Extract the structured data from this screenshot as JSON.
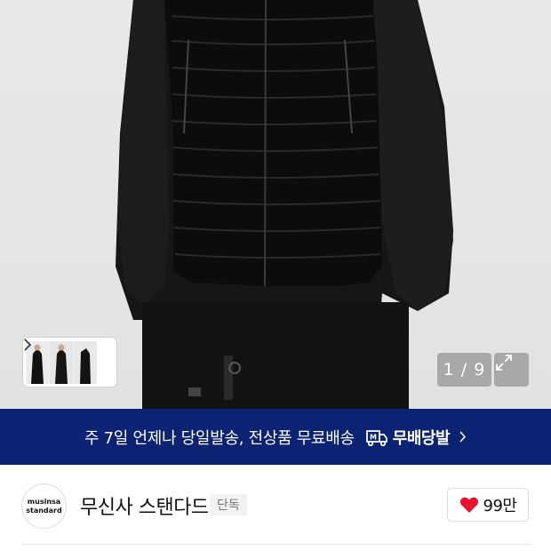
{
  "product": {
    "image_alt": "black padded vest worn over black shirt",
    "thumbnail_alt": "product thumbnails",
    "counter": "1 / 9"
  },
  "banner": {
    "text": "주 7일 언제나 당일발송, 전상품 무료배송",
    "logo_text": "무배당발"
  },
  "brand": {
    "logo_line1": "musinsa",
    "logo_line2": "standard",
    "name": "무신사 스탠다드",
    "tag": "단독",
    "likes": "99만"
  },
  "colors": {
    "banner_bg": "#0c2272",
    "heart": "#e8142b"
  }
}
